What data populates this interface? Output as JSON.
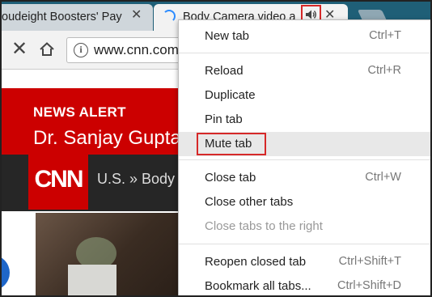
{
  "tabs": [
    {
      "title": "oudeight Boosters' Pay",
      "close": "✕"
    },
    {
      "title": "Body Camera video a",
      "close": "✕",
      "audio_icon": "speaker-icon"
    }
  ],
  "toolbar": {
    "url": "www.cnn.com",
    "stop_glyph": "✕",
    "info_glyph": "i"
  },
  "page": {
    "news_alert": "NEWS ALERT",
    "headline": "Dr. Sanjay Gupta",
    "logo": "CNN",
    "breadcrumb": "U.S.  »  Body"
  },
  "context_menu": {
    "items": [
      {
        "label": "New tab",
        "shortcut": "Ctrl+T"
      },
      {
        "label": "Reload",
        "shortcut": "Ctrl+R"
      },
      {
        "label": "Duplicate",
        "shortcut": ""
      },
      {
        "label": "Pin tab",
        "shortcut": ""
      },
      {
        "label": "Mute tab",
        "shortcut": ""
      },
      {
        "label": "Close tab",
        "shortcut": "Ctrl+W"
      },
      {
        "label": "Close other tabs",
        "shortcut": ""
      },
      {
        "label": "Close tabs to the right",
        "shortcut": ""
      },
      {
        "label": "Reopen closed tab",
        "shortcut": "Ctrl+Shift+T"
      },
      {
        "label": "Bookmark all tabs...",
        "shortcut": "Ctrl+Shift+D"
      }
    ]
  },
  "colors": {
    "tabstrip": "#1f5f77",
    "cnn_red": "#cc0000",
    "highlight_box": "#d62828"
  }
}
